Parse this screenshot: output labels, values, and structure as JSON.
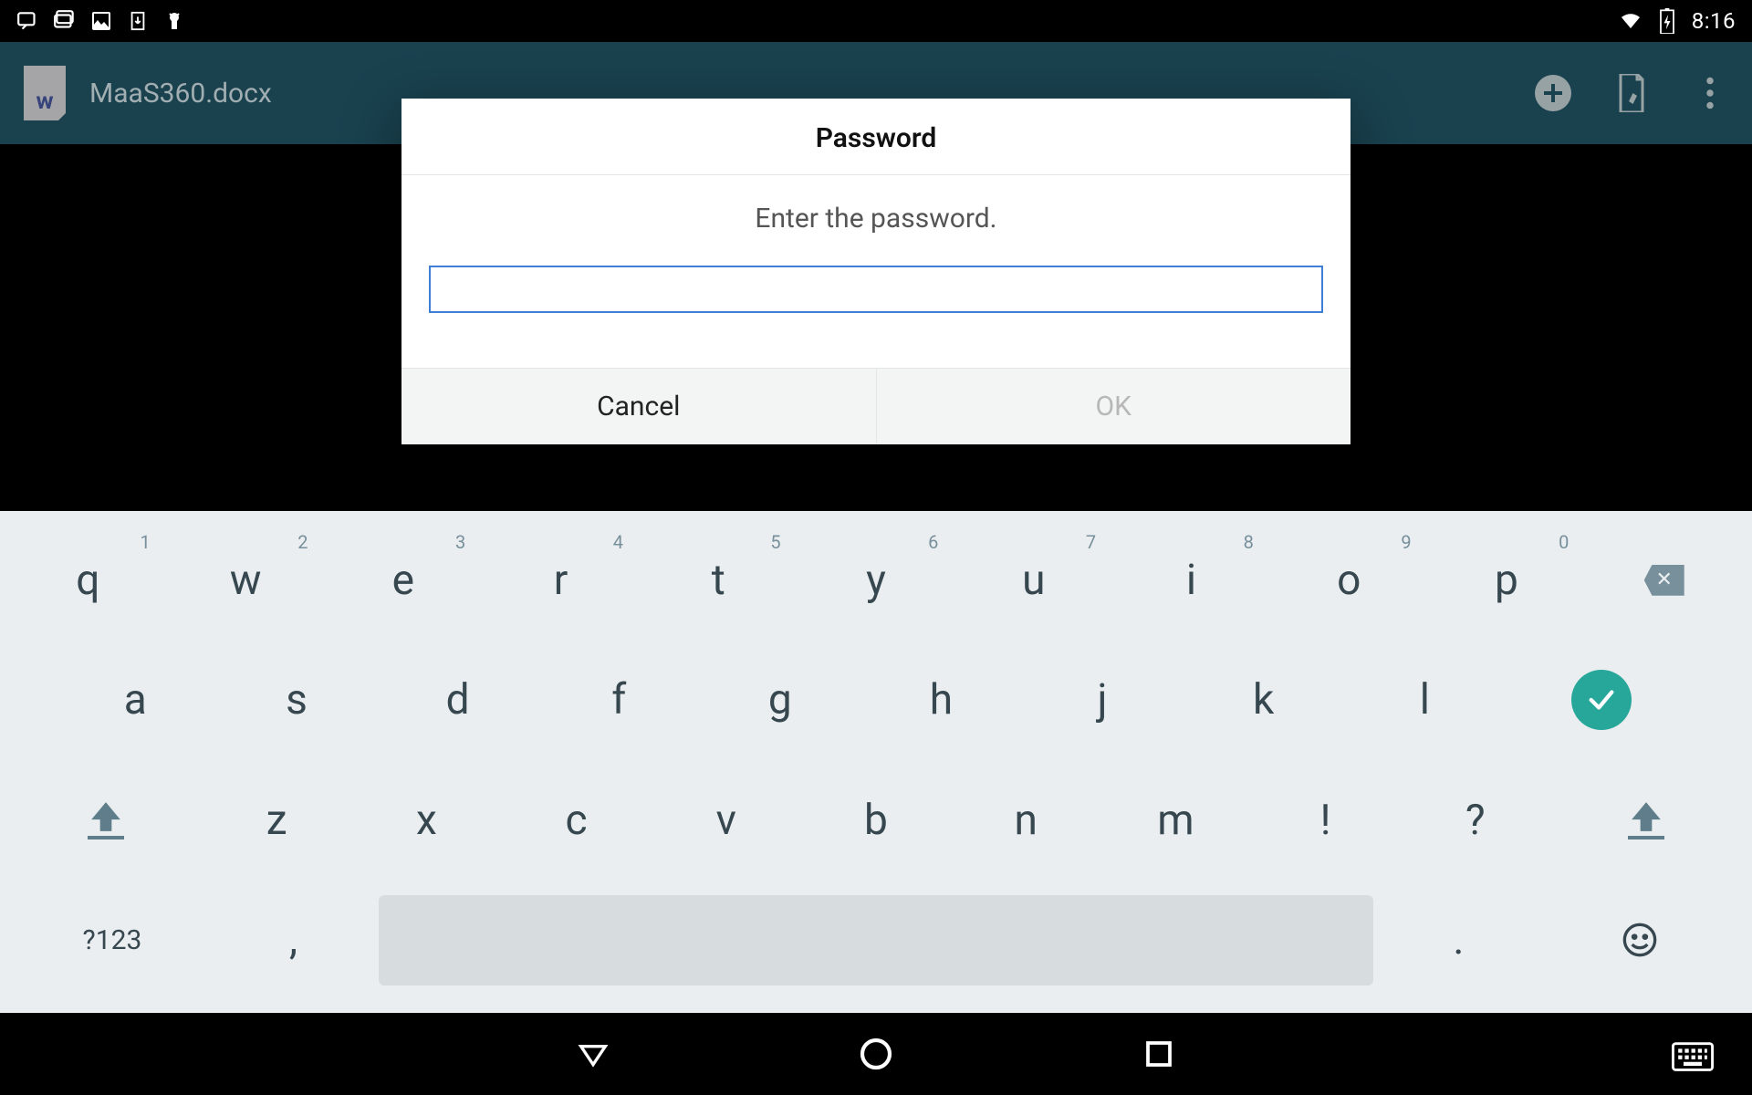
{
  "status": {
    "time": "8:16"
  },
  "appbar": {
    "doc_letter": "w",
    "title": "MaaS360.docx"
  },
  "dialog": {
    "title": "Password",
    "message": "Enter the password.",
    "input_value": "",
    "cancel_label": "Cancel",
    "ok_label": "OK"
  },
  "keyboard": {
    "row1": [
      {
        "k": "q",
        "n": "1"
      },
      {
        "k": "w",
        "n": "2"
      },
      {
        "k": "e",
        "n": "3"
      },
      {
        "k": "r",
        "n": "4"
      },
      {
        "k": "t",
        "n": "5"
      },
      {
        "k": "y",
        "n": "6"
      },
      {
        "k": "u",
        "n": "7"
      },
      {
        "k": "i",
        "n": "8"
      },
      {
        "k": "o",
        "n": "9"
      },
      {
        "k": "p",
        "n": "0"
      }
    ],
    "row2": [
      "a",
      "s",
      "d",
      "f",
      "g",
      "h",
      "j",
      "k",
      "l"
    ],
    "row3": [
      "z",
      "x",
      "c",
      "v",
      "b",
      "n",
      "m",
      "!",
      "?"
    ],
    "symbols_label": "?123",
    "comma": ",",
    "period": "."
  }
}
